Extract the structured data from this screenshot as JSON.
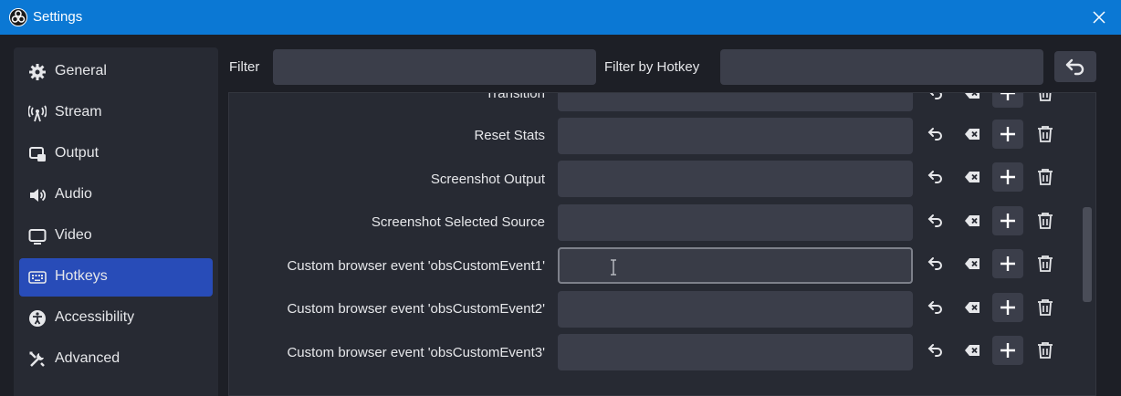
{
  "window": {
    "title": "Settings"
  },
  "sidebar": {
    "items": [
      {
        "label": "General",
        "icon": "gear-icon"
      },
      {
        "label": "Stream",
        "icon": "antenna-icon"
      },
      {
        "label": "Output",
        "icon": "output-icon"
      },
      {
        "label": "Audio",
        "icon": "speaker-icon"
      },
      {
        "label": "Video",
        "icon": "monitor-icon"
      },
      {
        "label": "Hotkeys",
        "icon": "keyboard-icon",
        "active": true
      },
      {
        "label": "Accessibility",
        "icon": "accessibility-icon"
      },
      {
        "label": "Advanced",
        "icon": "tools-icon"
      }
    ]
  },
  "filters": {
    "filter_label": "Filter",
    "filter_value": "",
    "hotkey_label": "Filter by Hotkey",
    "hotkey_value": ""
  },
  "hotkeys": {
    "rows": [
      {
        "label": "Transition",
        "value": ""
      },
      {
        "label": "Reset Stats",
        "value": ""
      },
      {
        "label": "Screenshot Output",
        "value": ""
      },
      {
        "label": "Screenshot Selected Source",
        "value": ""
      },
      {
        "label": "Custom browser event 'obsCustomEvent1'",
        "value": "",
        "focused": true
      },
      {
        "label": "Custom browser event 'obsCustomEvent2'",
        "value": ""
      },
      {
        "label": "Custom browser event 'obsCustomEvent3'",
        "value": ""
      }
    ]
  },
  "colors": {
    "titlebar": "#0b78d4",
    "accent": "#284cb8",
    "background": "#1d1f26",
    "panel": "#272a33",
    "input": "#3b3e4a"
  }
}
